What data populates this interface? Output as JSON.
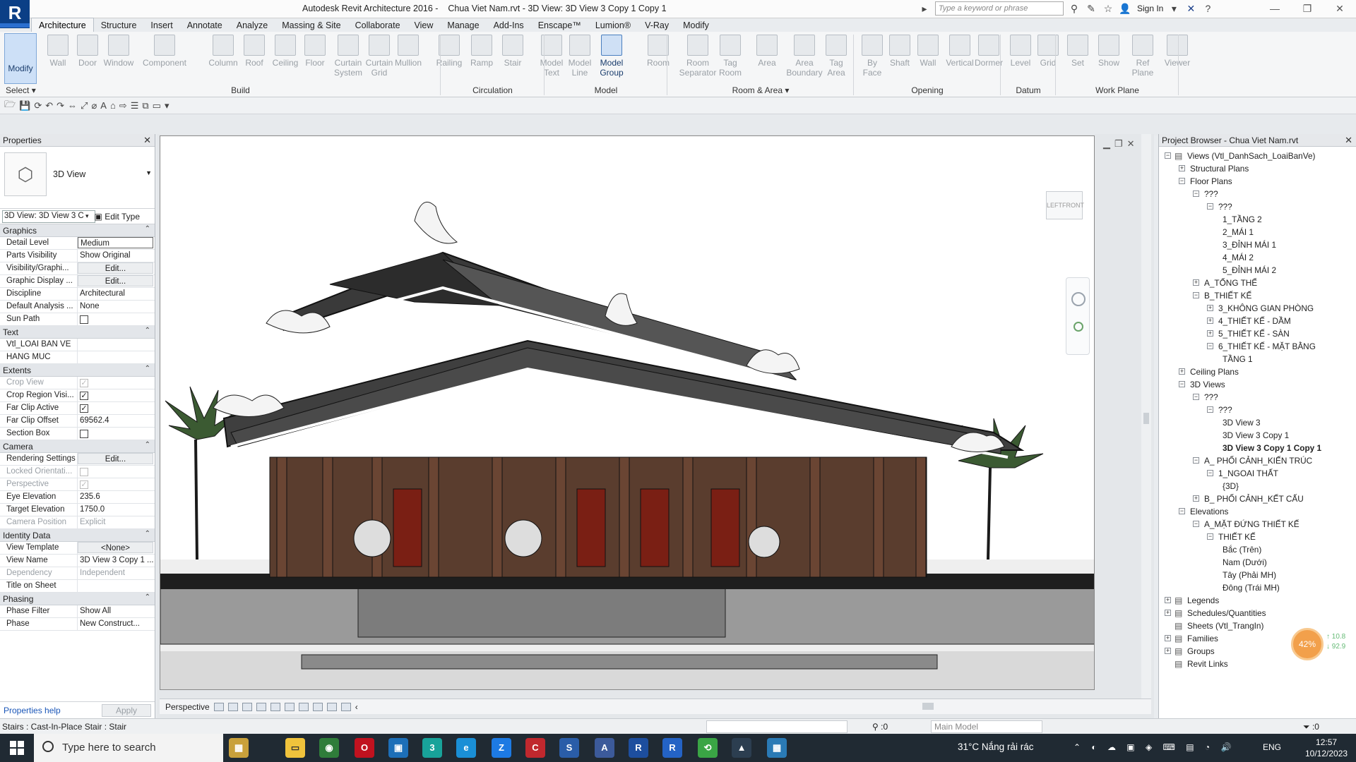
{
  "window": {
    "app_logo_letter": "R",
    "title": "Autodesk Revit Architecture 2016 -    Chua Viet Nam.rvt - 3D View: 3D View 3 Copy 1 Copy 1",
    "search_placeholder": "Type a keyword or phrase",
    "sign_in": "Sign In"
  },
  "menu_tabs": [
    "Architecture",
    "Structure",
    "Insert",
    "Annotate",
    "Analyze",
    "Massing & Site",
    "Collaborate",
    "View",
    "Manage",
    "Add-Ins",
    "Enscape™",
    "Lumion®",
    "V-Ray",
    "Modify"
  ],
  "active_tab": "Architecture",
  "ribbon": {
    "modify": "Modify",
    "select": "Select",
    "buttons": [
      {
        "l1": "Wall",
        "l2": ""
      },
      {
        "l1": "Door",
        "l2": ""
      },
      {
        "l1": "Window",
        "l2": ""
      },
      {
        "l1": "Component",
        "l2": ""
      },
      {
        "l1": "Column",
        "l2": ""
      },
      {
        "l1": "Roof",
        "l2": ""
      },
      {
        "l1": "Ceiling",
        "l2": ""
      },
      {
        "l1": "Floor",
        "l2": ""
      },
      {
        "l1": "Curtain",
        "l2": "System"
      },
      {
        "l1": "Curtain",
        "l2": "Grid"
      },
      {
        "l1": "Mullion",
        "l2": ""
      },
      {
        "l1": "Railing",
        "l2": ""
      },
      {
        "l1": "Ramp",
        "l2": ""
      },
      {
        "l1": "Stair",
        "l2": ""
      },
      {
        "l1": "Model",
        "l2": "Text"
      },
      {
        "l1": "Model",
        "l2": "Line"
      },
      {
        "l1": "Model",
        "l2": "Group"
      },
      {
        "l1": "Room",
        "l2": ""
      },
      {
        "l1": "Room",
        "l2": "Separator"
      },
      {
        "l1": "Tag",
        "l2": "Room"
      },
      {
        "l1": "Area",
        "l2": ""
      },
      {
        "l1": "Area",
        "l2": "Boundary"
      },
      {
        "l1": "Tag",
        "l2": "Area"
      },
      {
        "l1": "By",
        "l2": "Face"
      },
      {
        "l1": "Shaft",
        "l2": ""
      },
      {
        "l1": "Wall",
        "l2": ""
      },
      {
        "l1": "Vertical",
        "l2": ""
      },
      {
        "l1": "Dormer",
        "l2": ""
      },
      {
        "l1": "Level",
        "l2": ""
      },
      {
        "l1": "Grid",
        "l2": ""
      },
      {
        "l1": "Set",
        "l2": ""
      },
      {
        "l1": "Show",
        "l2": ""
      },
      {
        "l1": "Ref",
        "l2": "Plane"
      },
      {
        "l1": "Viewer",
        "l2": ""
      }
    ],
    "panels": [
      "Build",
      "Circulation",
      "Model",
      "Room & Area ▾",
      "Opening",
      "Datum",
      "Work Plane"
    ]
  },
  "properties": {
    "title": "Properties",
    "type_name": "3D View",
    "instance_selector": "3D View: 3D View 3 C",
    "edit_type": "Edit Type",
    "groups": [
      {
        "name": "Graphics",
        "rows": [
          {
            "k": "Detail Level",
            "v": "Medium",
            "style": "boxed"
          },
          {
            "k": "Parts Visibility",
            "v": "Show Original"
          },
          {
            "k": "Visibility/Graphi...",
            "v": "Edit...",
            "style": "btn"
          },
          {
            "k": "Graphic Display ...",
            "v": "Edit...",
            "style": "btn"
          },
          {
            "k": "Discipline",
            "v": "Architectural"
          },
          {
            "k": "Default Analysis ...",
            "v": "None"
          },
          {
            "k": "Sun Path",
            "v": "",
            "check": "off"
          }
        ]
      },
      {
        "name": "Text",
        "rows": [
          {
            "k": "Vtl_LOAI BAN VE",
            "v": ""
          },
          {
            "k": "HANG MUC",
            "v": ""
          }
        ]
      },
      {
        "name": "Extents",
        "rows": [
          {
            "k": "Crop View",
            "v": "",
            "check": "disabled",
            "dim": true
          },
          {
            "k": "Crop Region Visi...",
            "v": "",
            "check": "on"
          },
          {
            "k": "Far Clip Active",
            "v": "",
            "check": "on"
          },
          {
            "k": "Far Clip Offset",
            "v": "69562.4"
          },
          {
            "k": "Section Box",
            "v": "",
            "check": "off"
          }
        ]
      },
      {
        "name": "Camera",
        "rows": [
          {
            "k": "Rendering Settings",
            "v": "Edit...",
            "style": "btn"
          },
          {
            "k": "Locked Orientati...",
            "v": "",
            "check": "disabledoff",
            "dim": true
          },
          {
            "k": "Perspective",
            "v": "",
            "check": "disabled",
            "dim": true
          },
          {
            "k": "Eye Elevation",
            "v": "235.6"
          },
          {
            "k": "Target Elevation",
            "v": "1750.0"
          },
          {
            "k": "Camera Position",
            "v": "Explicit",
            "dim": true
          }
        ]
      },
      {
        "name": "Identity Data",
        "rows": [
          {
            "k": "View Template",
            "v": "<None>",
            "style": "btn"
          },
          {
            "k": "View Name",
            "v": "3D View 3 Copy 1 ..."
          },
          {
            "k": "Dependency",
            "v": "Independent",
            "dim": true
          },
          {
            "k": "Title on Sheet",
            "v": ""
          }
        ]
      },
      {
        "name": "Phasing",
        "rows": [
          {
            "k": "Phase Filter",
            "v": "Show All"
          },
          {
            "k": "Phase",
            "v": "New Construct..."
          }
        ]
      }
    ],
    "help_link": "Properties help",
    "apply": "Apply"
  },
  "view": {
    "cube_left": "LEFT",
    "cube_front": "FRONT",
    "bar_label": "Perspective"
  },
  "browser": {
    "title": "Project Browser - Chua Viet Nam.rvt",
    "items": [
      {
        "d": 0,
        "t": "−",
        "label": "Views (Vtl_DanhSach_LoaiBanVe)",
        "icon": true
      },
      {
        "d": 1,
        "t": "+",
        "label": "Structural Plans"
      },
      {
        "d": 1,
        "t": "−",
        "label": "Floor Plans"
      },
      {
        "d": 2,
        "t": "−",
        "label": "???"
      },
      {
        "d": 3,
        "t": "−",
        "label": "???"
      },
      {
        "d": 4,
        "t": "",
        "label": "1_TẦNG 2"
      },
      {
        "d": 4,
        "t": "",
        "label": "2_MÁI 1"
      },
      {
        "d": 4,
        "t": "",
        "label": "3_ĐỈNH MÁI 1"
      },
      {
        "d": 4,
        "t": "",
        "label": "4_MÁI 2"
      },
      {
        "d": 4,
        "t": "",
        "label": "5_ĐỈNH MÁI 2"
      },
      {
        "d": 2,
        "t": "+",
        "label": "A_TỔNG THỂ"
      },
      {
        "d": 2,
        "t": "−",
        "label": "B_THIẾT KẾ"
      },
      {
        "d": 3,
        "t": "+",
        "label": "3_KHÔNG GIAN PHÒNG"
      },
      {
        "d": 3,
        "t": "+",
        "label": "4_THIẾT KẾ - DẦM"
      },
      {
        "d": 3,
        "t": "+",
        "label": "5_THIẾT KẾ - SÀN"
      },
      {
        "d": 3,
        "t": "−",
        "label": "6_THIẾT KẾ - MẶT BẰNG"
      },
      {
        "d": 4,
        "t": "",
        "label": "TẦNG 1"
      },
      {
        "d": 1,
        "t": "+",
        "label": "Ceiling Plans"
      },
      {
        "d": 1,
        "t": "−",
        "label": "3D Views"
      },
      {
        "d": 2,
        "t": "−",
        "label": "???"
      },
      {
        "d": 3,
        "t": "−",
        "label": "???"
      },
      {
        "d": 4,
        "t": "",
        "label": "3D View 3"
      },
      {
        "d": 4,
        "t": "",
        "label": "3D View 3 Copy 1"
      },
      {
        "d": 4,
        "t": "",
        "label": "3D View 3 Copy 1 Copy 1",
        "sel": true
      },
      {
        "d": 2,
        "t": "−",
        "label": "A_ PHỐI CẢNH_KIẾN TRÚC"
      },
      {
        "d": 3,
        "t": "−",
        "label": "1_NGOAI THẤT"
      },
      {
        "d": 4,
        "t": "",
        "label": "{3D}"
      },
      {
        "d": 2,
        "t": "+",
        "label": "B_ PHỐI CẢNH_KẾT CẤU"
      },
      {
        "d": 1,
        "t": "−",
        "label": "Elevations"
      },
      {
        "d": 2,
        "t": "−",
        "label": "A_MẶT ĐỨNG THIẾT KẾ"
      },
      {
        "d": 3,
        "t": "−",
        "label": "THIẾT KẾ"
      },
      {
        "d": 4,
        "t": "",
        "label": "Bắc (Trên)"
      },
      {
        "d": 4,
        "t": "",
        "label": "Nam (Dưới)"
      },
      {
        "d": 4,
        "t": "",
        "label": "Tây (Phải MH)"
      },
      {
        "d": 4,
        "t": "",
        "label": "Đông (Trái MH)"
      },
      {
        "d": 0,
        "t": "+",
        "label": "Legends",
        "icon": true
      },
      {
        "d": 0,
        "t": "+",
        "label": "Schedules/Quantities",
        "icon": true
      },
      {
        "d": 0,
        "t": "",
        "label": "Sheets (Vtl_TrangIn)",
        "icon": true
      },
      {
        "d": 0,
        "t": "+",
        "label": "Families",
        "icon": true
      },
      {
        "d": 0,
        "t": "+",
        "label": "Groups",
        "icon": true
      },
      {
        "d": 0,
        "t": "",
        "label": "Revit Links",
        "icon": true
      }
    ],
    "badge": "42%",
    "net_up": "↑ 10.8",
    "net_down": "↓ 92.9"
  },
  "status": {
    "text": "Stairs : Cast-In-Place Stair : Stair",
    "sel_count": ":0",
    "model": "Main Model",
    "filter_count": ":0"
  },
  "taskbar": {
    "search_placeholder": "Type here to search",
    "weather": "31°C  Nắng rải rác",
    "lang": "ENG",
    "time": "12:57",
    "date": "10/12/2023"
  }
}
